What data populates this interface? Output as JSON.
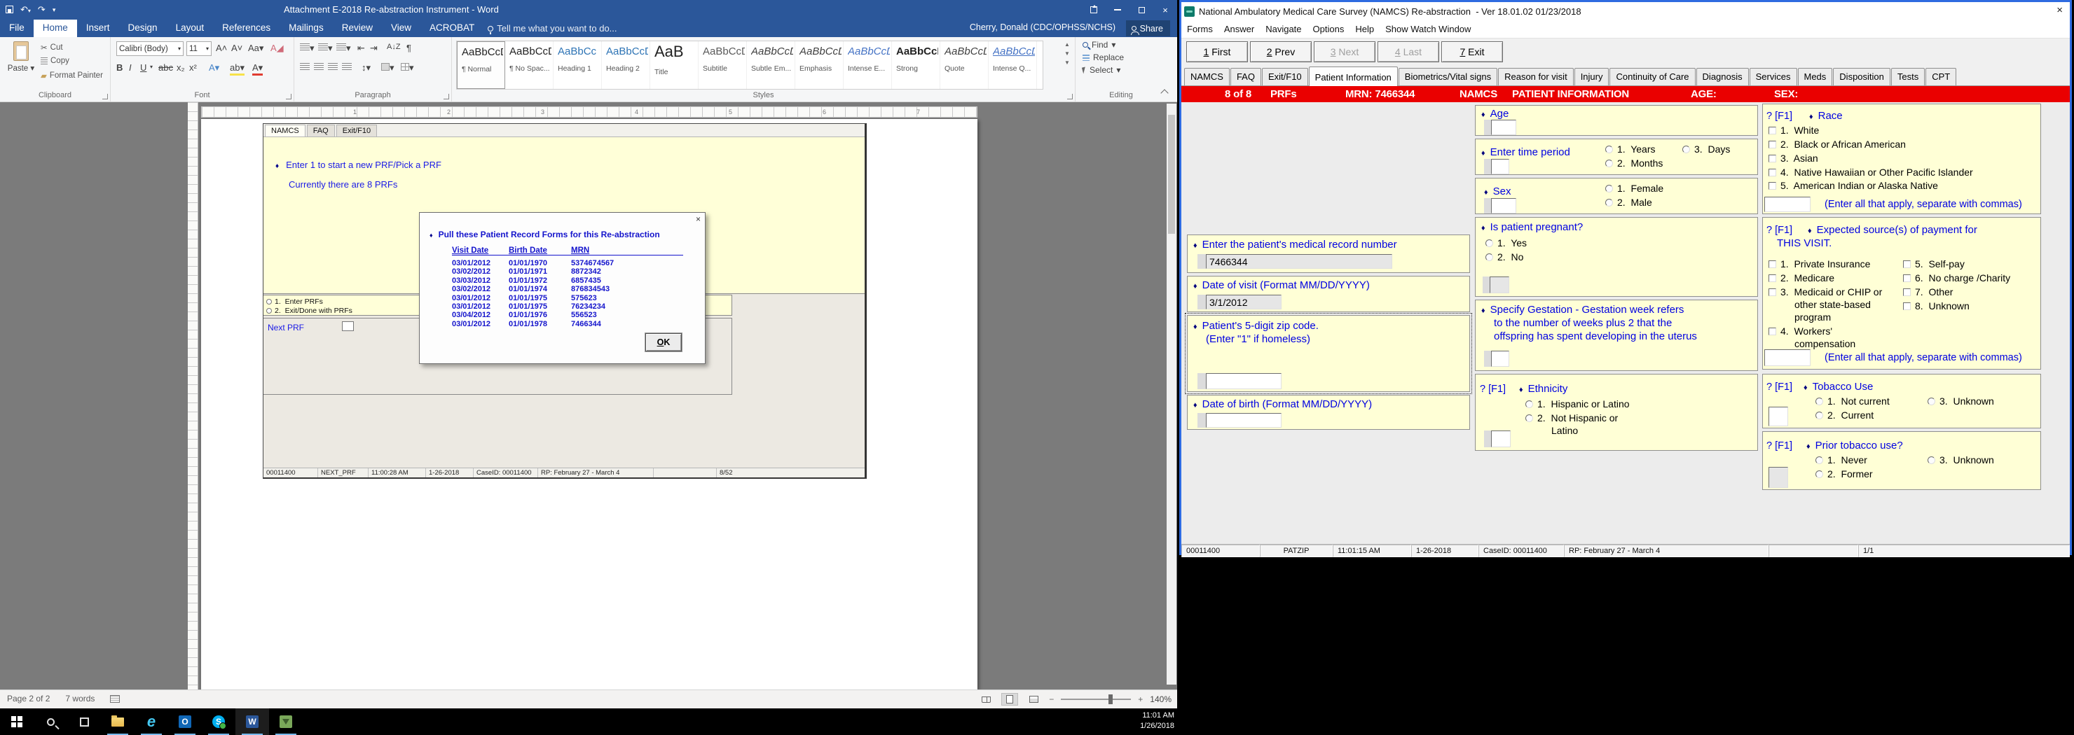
{
  "colors": {
    "word_blue": "#2B579A",
    "panel_yellow": "#FFFFD6",
    "label_blue": "#0000E1",
    "header_red": "#EA0000",
    "taskbar_indicator": "#76B9ED"
  },
  "taskbar": {
    "time": "11:01 AM",
    "date": "1/26/2018"
  },
  "word": {
    "title": "Attachment E-2018 Re-abstraction Instrument - Word",
    "menu": [
      "File",
      "Home",
      "Insert",
      "Design",
      "Layout",
      "References",
      "Mailings",
      "Review",
      "View",
      "ACROBAT"
    ],
    "tell_me": "Tell me what you want to do...",
    "user": "Cherry, Donald (CDC/OPHSS/NCHS)",
    "share": "Share",
    "ribbon": {
      "clipboard": {
        "label": "Clipboard",
        "paste": "Paste",
        "cut": "Cut",
        "copy": "Copy",
        "painter": "Format Painter"
      },
      "font": {
        "label": "Font",
        "family": "Calibri (Body)",
        "size": "11"
      },
      "paragraph": {
        "label": "Paragraph"
      },
      "styles": {
        "label": "Styles",
        "items": [
          {
            "preview": "AaBbCcDc",
            "name": "¶ Normal"
          },
          {
            "preview": "AaBbCcDc",
            "name": "¶ No Spac..."
          },
          {
            "preview": "AaBbCc",
            "name": "Heading 1"
          },
          {
            "preview": "AaBbCcD",
            "name": "Heading 2"
          },
          {
            "preview": "AaB",
            "name": "Title"
          },
          {
            "preview": "AaBbCcD",
            "name": "Subtitle"
          },
          {
            "preview": "AaBbCcDc",
            "name": "Subtle Em..."
          },
          {
            "preview": "AaBbCcDc",
            "name": "Emphasis"
          },
          {
            "preview": "AaBbCcDc",
            "name": "Intense E..."
          },
          {
            "preview": "AaBbCcDc",
            "name": "Strong"
          },
          {
            "preview": "AaBbCcDc",
            "name": "Quote"
          },
          {
            "preview": "AaBbCcDc",
            "name": "Intense Q..."
          }
        ]
      },
      "editing": {
        "label": "Editing",
        "find": "Find",
        "replace": "Replace",
        "select": "Select"
      }
    },
    "ruler_numbers": [
      "1",
      "2",
      "3",
      "4",
      "5",
      "6",
      "7"
    ],
    "status": {
      "page": "Page 2 of 2",
      "words": "7 words",
      "zoom": "140%"
    }
  },
  "doc": {
    "app_tabs": [
      "NAMCS",
      "FAQ",
      "Exit/F10"
    ],
    "line1": "Enter 1 to start a new PRF/Pick a PRF",
    "line2": "Currently there are 8 PRFs",
    "radio1": "1.  Enter PRFs",
    "radio2": "2.  Exit/Done with PRFs",
    "next_prf": "Next PRF",
    "status": [
      "00011400",
      "NEXT_PRF",
      "11:00:28 AM",
      "1-26-2018",
      "CaseID: 00011400",
      "RP: February 27 - March 4",
      "8/52"
    ],
    "dialog": {
      "title": "Pull these Patient Record Forms for this Re-abstraction",
      "col_visit": "Visit Date",
      "col_birth": "Birth Date",
      "col_mrn": "MRN",
      "rows": [
        {
          "visit": "03/01/2012",
          "birth": "01/01/1970",
          "mrn": "5374674567"
        },
        {
          "visit": "03/02/2012",
          "birth": "01/01/1971",
          "mrn": "8872342"
        },
        {
          "visit": "03/03/2012",
          "birth": "01/01/1972",
          "mrn": "6857435"
        },
        {
          "visit": "03/02/2012",
          "birth": "01/01/1974",
          "mrn": "876834543"
        },
        {
          "visit": "03/01/2012",
          "birth": "01/01/1975",
          "mrn": "575623"
        },
        {
          "visit": "03/01/2012",
          "birth": "01/01/1975",
          "mrn": "76234234"
        },
        {
          "visit": "03/04/2012",
          "birth": "01/01/1976",
          "mrn": "556523"
        },
        {
          "visit": "03/01/2012",
          "birth": "01/01/1978",
          "mrn": "7466344"
        }
      ],
      "ok_key": "O",
      "ok_rest": "K"
    }
  },
  "namcs": {
    "title": "National Ambulatory Medical Care Survey (NAMCS) Re-abstraction  - Ver 18.01.02 01/23/2018",
    "menus": [
      "Forms",
      "Answer",
      "Navigate",
      "Options",
      "Help",
      "Show Watch Window"
    ],
    "nav": [
      {
        "key": "1",
        "rest": " First"
      },
      {
        "key": "2",
        "rest": " Prev"
      },
      {
        "key": "3",
        "rest": " Next"
      },
      {
        "key": "4",
        "rest": " Last"
      },
      {
        "key": "7",
        "rest": " Exit"
      }
    ],
    "tabs": [
      "NAMCS",
      "FAQ",
      "Exit/F10",
      "Patient Information",
      "Biometrics/Vital signs",
      "Reason for visit",
      "Injury",
      "Continuity of Care",
      "Diagnosis",
      "Services",
      "Meds",
      "Disposition",
      "Tests",
      "CPT"
    ],
    "header": {
      "count": "8 of 8",
      "prfs": "PRFs",
      "mrn": "MRN: 7466344",
      "namcs": "NAMCS",
      "info": "PATIENT INFORMATION",
      "age": "AGE:",
      "sex": "SEX:"
    },
    "help_tag": "? [F1]",
    "note_commas": "(Enter all that apply, separate with commas)",
    "panels": {
      "mrn": {
        "q": "Enter the patient's medical record number",
        "value": "7466344"
      },
      "visit_date": {
        "q": "Date of visit (Format MM/DD/YYYY)",
        "value": "3/1/2012"
      },
      "zip": {
        "q1": "Patient's 5-digit zip code.",
        "q2": "(Enter \"1\" if homeless)",
        "value": ""
      },
      "dob": {
        "q": "Date of birth (Format MM/DD/YYYY)",
        "value": ""
      },
      "age": {
        "q": "Age"
      },
      "time_period": {
        "q": "Enter time period",
        "opt1": "1.  Years",
        "opt2": "2.  Months",
        "opt3": "3.  Days"
      },
      "sex": {
        "q": "Sex",
        "opt1": "1.  Female",
        "opt2": "2.  Male"
      },
      "pregnant": {
        "q": "Is patient pregnant?",
        "opt1": "1.  Yes",
        "opt2": "2.  No"
      },
      "gestation": {
        "l1": "Specify Gestation - Gestation week refers",
        "l2": "to the number of weeks plus 2 that the",
        "l3": "offspring has spent developing in the uterus"
      },
      "ethnicity": {
        "q": "Ethnicity",
        "opt1": "1.  Hispanic or Latino",
        "opt2": "2.  Not Hispanic or",
        "opt2b": "Latino"
      },
      "race": {
        "q": "Race",
        "opt1": "1.  White",
        "opt2": "2.  Black or African American",
        "opt3": "3.  Asian",
        "opt4": "4.  Native Hawaiian or Other Pacific Islander",
        "opt5": "5.  American Indian or Alaska Native"
      },
      "payment": {
        "q1": "Expected source(s) of payment for",
        "q2": "THIS VISIT.",
        "a1": "1.  Private Insurance",
        "a2": "2.  Medicare",
        "a3": "3.  Medicaid or CHIP or",
        "a3b": "other state-based",
        "a3c": "program",
        "a4": "4.  Workers'",
        "a4b": "compensation",
        "b1": "5.  Self-pay",
        "b2": "6.  No charge /Charity",
        "b3": "7.  Other",
        "b4": "8.  Unknown"
      },
      "tobacco": {
        "q": "Tobacco Use",
        "opt1": "1.  Not current",
        "opt2": "2.  Current",
        "opt3": "3.  Unknown"
      },
      "prior_tobacco": {
        "q": "Prior tobacco use?",
        "opt1": "1.  Never",
        "opt2": "2.  Former",
        "opt3": "3.  Unknown"
      }
    },
    "status": [
      "00011400",
      "PATZIP",
      "11:01:15 AM",
      "1-26-2018",
      "CaseID: 00011400",
      "RP: February 27 - March 4",
      "1/1"
    ]
  }
}
